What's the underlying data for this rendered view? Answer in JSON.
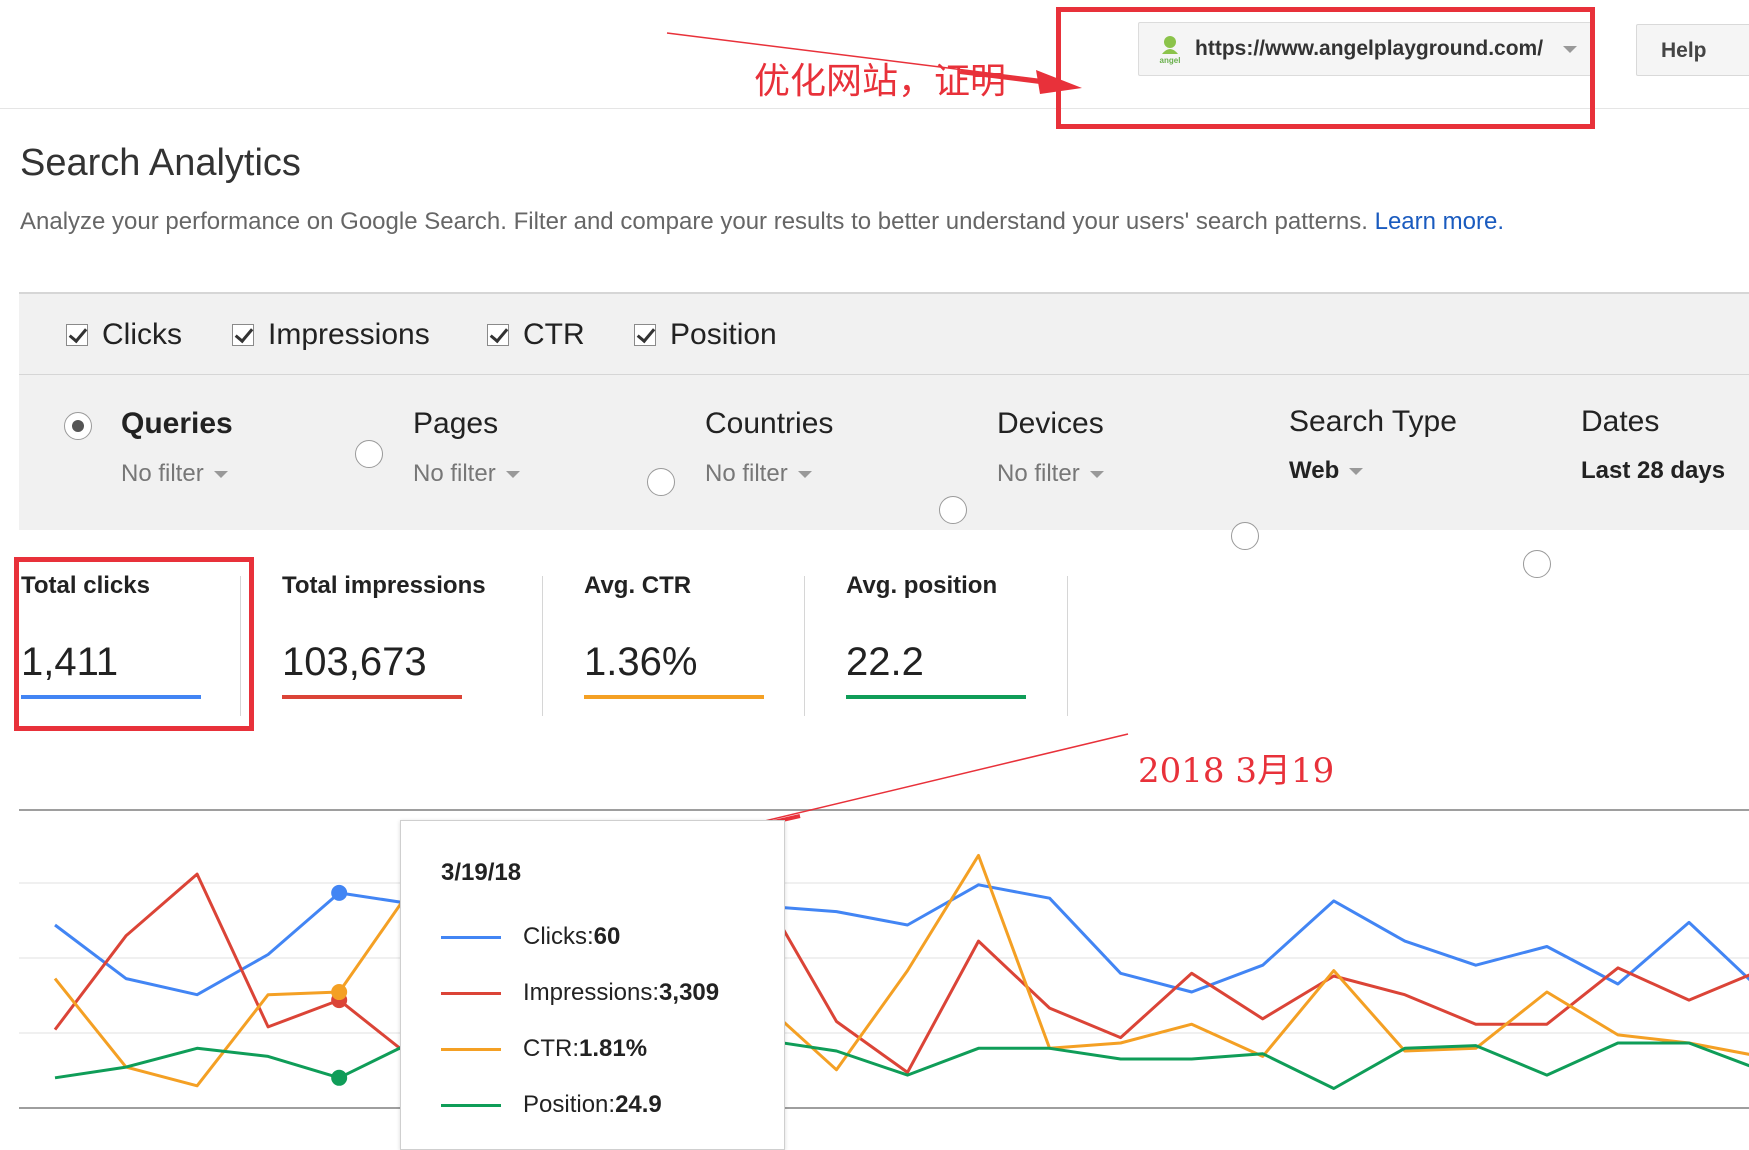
{
  "header": {
    "site_url": "https://www.angelplayground.com/",
    "site_logo_text": "angel",
    "help_label": "Help",
    "annotation_site": "优化网站，证明"
  },
  "page": {
    "title": "Search Analytics",
    "description": "Analyze your performance on Google Search. Filter and compare your results to better understand your users' search patterns.",
    "learn_more": "Learn more."
  },
  "metrics": [
    {
      "label": "Clicks",
      "checked": true
    },
    {
      "label": "Impressions",
      "checked": true
    },
    {
      "label": "CTR",
      "checked": true
    },
    {
      "label": "Position",
      "checked": true
    }
  ],
  "groupings": [
    {
      "label": "Queries",
      "filter": "No filter",
      "selected": true
    },
    {
      "label": "Pages",
      "filter": "No filter",
      "selected": false
    },
    {
      "label": "Countries",
      "filter": "No filter",
      "selected": false
    },
    {
      "label": "Devices",
      "filter": "No filter",
      "selected": false
    },
    {
      "label": "Search Type",
      "filter": "Web",
      "selected": false
    },
    {
      "label": "Dates",
      "filter": "Last 28 days",
      "selected": false
    }
  ],
  "stats": [
    {
      "label": "Total clicks",
      "value": "1,411",
      "color": "#4285f4"
    },
    {
      "label": "Total impressions",
      "value": "103,673",
      "color": "#db4437"
    },
    {
      "label": "Avg. CTR",
      "value": "1.36%",
      "color": "#f4a024"
    },
    {
      "label": "Avg. position",
      "value": "22.2",
      "color": "#0f9d58"
    }
  ],
  "annotation_date": "2018  3月19",
  "tooltip": {
    "date": "3/19/18",
    "rows": [
      {
        "label": "Clicks: ",
        "value": "60",
        "color": "#4285f4"
      },
      {
        "label": "Impressions: ",
        "value": "3,309",
        "color": "#db4437"
      },
      {
        "label": "CTR: ",
        "value": "1.81%",
        "color": "#f4a024"
      },
      {
        "label": "Position: ",
        "value": "24.9",
        "color": "#0f9d58"
      }
    ]
  },
  "colors": {
    "clicks": "#4285f4",
    "impressions": "#db4437",
    "ctr": "#f4a024",
    "position": "#0f9d58",
    "annotation": "#e8313a",
    "link": "#1a5bbf"
  },
  "chart_data": {
    "type": "line",
    "title": "",
    "xlabel": "",
    "ylabel": "",
    "x_count": 25,
    "highlight_index": 4,
    "hidden_by_tooltip": [
      6,
      10
    ],
    "grid": true,
    "series": [
      {
        "name": "Clicks",
        "values": [
          0.72,
          0.52,
          0.46,
          0.61,
          0.84,
          0.8,
          0.76,
          0.78,
          0.8,
          0.76,
          0.79,
          0.77,
          0.72,
          0.87,
          0.82,
          0.54,
          0.47,
          0.57,
          0.81,
          0.66,
          0.57,
          0.64,
          0.5,
          0.73,
          0.48
        ]
      },
      {
        "name": "Impressions",
        "values": [
          0.33,
          0.68,
          0.91,
          0.34,
          0.44,
          0.23,
          0.4,
          0.52,
          0.58,
          0.59,
          0.82,
          0.36,
          0.17,
          0.66,
          0.41,
          0.3,
          0.54,
          0.37,
          0.53,
          0.46,
          0.35,
          0.35,
          0.56,
          0.44,
          0.55
        ]
      },
      {
        "name": "CTR",
        "values": [
          0.52,
          0.19,
          0.12,
          0.46,
          0.47,
          0.85,
          0.55,
          0.4,
          0.38,
          0.58,
          0.42,
          0.18,
          0.55,
          0.98,
          0.26,
          0.28,
          0.35,
          0.23,
          0.55,
          0.25,
          0.26,
          0.47,
          0.31,
          0.28,
          0.23
        ]
      },
      {
        "name": "Position",
        "values": [
          0.15,
          0.19,
          0.26,
          0.23,
          0.15,
          0.28,
          0.3,
          0.32,
          0.31,
          0.28,
          0.29,
          0.25,
          0.16,
          0.26,
          0.26,
          0.22,
          0.22,
          0.24,
          0.11,
          0.26,
          0.27,
          0.16,
          0.28,
          0.28,
          0.18
        ]
      }
    ]
  }
}
